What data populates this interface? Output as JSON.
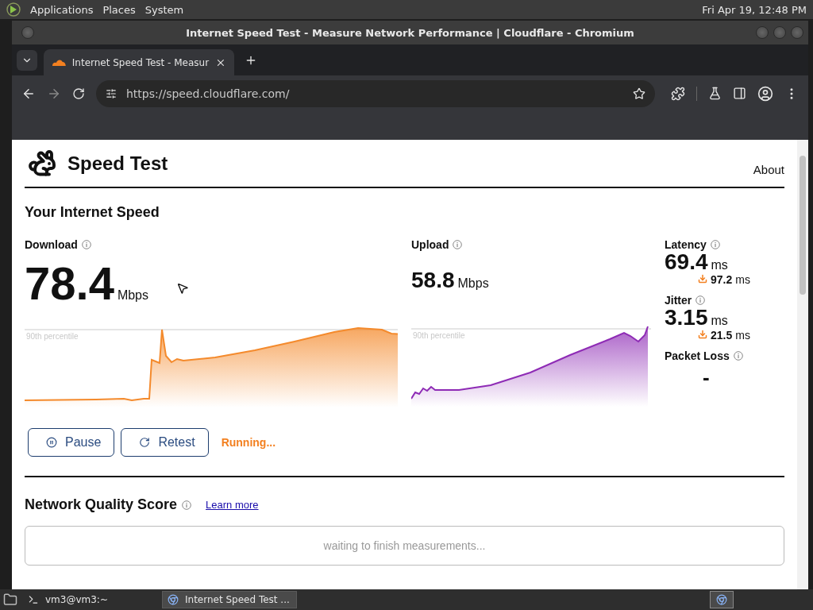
{
  "top_panel": {
    "menus": [
      "Applications",
      "Places",
      "System"
    ],
    "clock": "Fri Apr 19, 12:48 PM"
  },
  "window": {
    "title": "Internet Speed Test - Measure Network Performance | Cloudflare - Chromium"
  },
  "tabs": [
    {
      "label": "Internet Speed Test - Measur",
      "selected": true
    }
  ],
  "address_bar": {
    "url": "https://speed.cloudflare.com/"
  },
  "page": {
    "site_title": "Speed Test",
    "nav_link": "About",
    "section_title": "Your Internet Speed",
    "download": {
      "label": "Download",
      "value": "78.4",
      "unit": "Mbps",
      "percentile_label": "90th percentile"
    },
    "upload": {
      "label": "Upload",
      "value": "58.8",
      "unit": "Mbps",
      "percentile_label": "90th percentile"
    },
    "latency": {
      "label": "Latency",
      "value": "69.4",
      "unit": "ms",
      "loaded_value": "97.2",
      "loaded_unit": "ms"
    },
    "jitter": {
      "label": "Jitter",
      "value": "3.15",
      "unit": "ms",
      "loaded_value": "21.5",
      "loaded_unit": "ms"
    },
    "packet_loss": {
      "label": "Packet Loss",
      "value": "-"
    },
    "buttons": [
      {
        "kind": "pause",
        "label": "Pause"
      },
      {
        "kind": "retest",
        "label": "Retest"
      }
    ],
    "status": "Running...",
    "quality": {
      "title": "Network Quality Score",
      "link": "Learn more",
      "message": "waiting to finish measurements..."
    }
  },
  "taskbar": {
    "items": [
      {
        "kind": "terminal",
        "label": "vm3@vm3:~",
        "selected": false
      },
      {
        "kind": "browser",
        "label": "Internet Speed Test ...",
        "selected": true
      }
    ]
  }
}
